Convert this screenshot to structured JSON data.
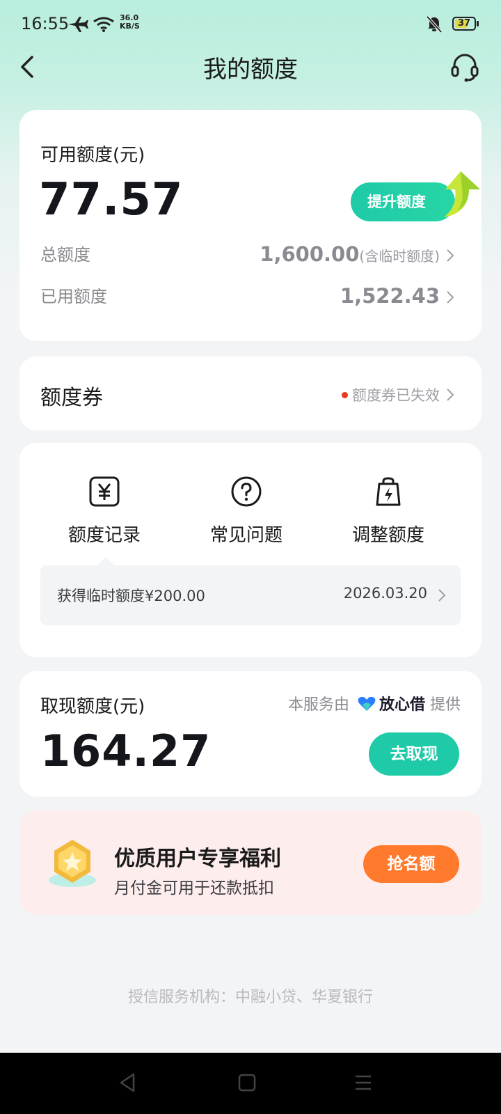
{
  "status_bar": {
    "time": "16:55",
    "speed_value": "36.0",
    "speed_unit": "KB/S",
    "battery": "37",
    "icons": [
      "airplane-icon",
      "wifi-icon",
      "mute-icon",
      "battery-icon"
    ]
  },
  "header": {
    "title": "我的额度"
  },
  "quota": {
    "label": "可用额度(元)",
    "amount": "77.57",
    "raise_button": "提升额度",
    "total_label": "总额度",
    "total_value": "1,600.00",
    "total_note": "(含临时额度)",
    "used_label": "已用额度",
    "used_value": "1,522.43"
  },
  "coupon": {
    "title": "额度券",
    "status": "额度券已失效"
  },
  "menu": {
    "items": [
      {
        "label": "额度记录",
        "icon": "yuan-icon"
      },
      {
        "label": "常见问题",
        "icon": "question-icon"
      },
      {
        "label": "调整额度",
        "icon": "bag-bolt-icon"
      }
    ],
    "notice_text": "获得临时额度¥200.00",
    "notice_date": "2026.03.20"
  },
  "cash": {
    "label": "取现额度(元)",
    "provider_prefix": "本服务由",
    "provider_brand": "放心借",
    "provider_suffix": "提供",
    "amount": "164.27",
    "button": "去取现"
  },
  "benefit": {
    "title": "优质用户专享福利",
    "subtitle": "月付金可用于还款抵扣",
    "button": "抢名额"
  },
  "footer": {
    "text": "授信服务机构：中融小贷、华夏银行"
  },
  "colors": {
    "accent": "#1ecaa8",
    "orange": "#ff7a2c",
    "benefit_bg": "#fdeeed",
    "status_dot": "#e8391d"
  }
}
